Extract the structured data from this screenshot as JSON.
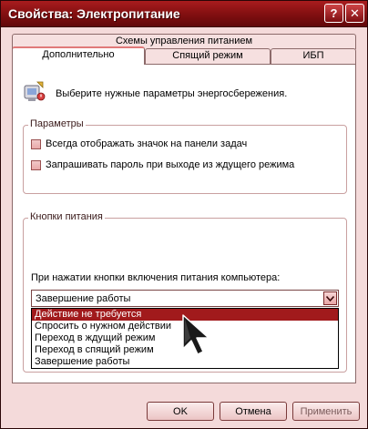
{
  "window": {
    "title": "Свойства: Электропитание",
    "help_glyph": "?",
    "close_glyph": "✕"
  },
  "tabs": {
    "top": "Схемы управления питанием",
    "row2": [
      "Дополнительно",
      "Спящий режим",
      "ИБП"
    ],
    "active": "Дополнительно"
  },
  "intro": {
    "icon": "power-options-icon",
    "text": "Выберите нужные параметры энергосбережения."
  },
  "params": {
    "label": "Параметры",
    "checkboxes": [
      {
        "label": "Всегда отображать значок на панели задач",
        "checked": false
      },
      {
        "label": "Запрашивать пароль при выходе из ждущего режима",
        "checked": false
      }
    ]
  },
  "power_buttons": {
    "label": "Кнопки питания",
    "field_label": "При нажатии кнопки включения питания компьютера:",
    "combo_value": "Завершение работы",
    "options": [
      "Действие не требуется",
      "Спросить о нужном действии",
      "Переход в ждущий режим",
      "Переход в спящий режим",
      "Завершение работы"
    ],
    "highlighted_option": "Действие не требуется"
  },
  "buttons": {
    "ok": "OK",
    "cancel": "Отмена",
    "apply": "Применить"
  },
  "colors": {
    "title_bar": "#871112",
    "panel": "#ffffff",
    "dialog": "#f4dada",
    "highlight": "#a11a1c"
  }
}
